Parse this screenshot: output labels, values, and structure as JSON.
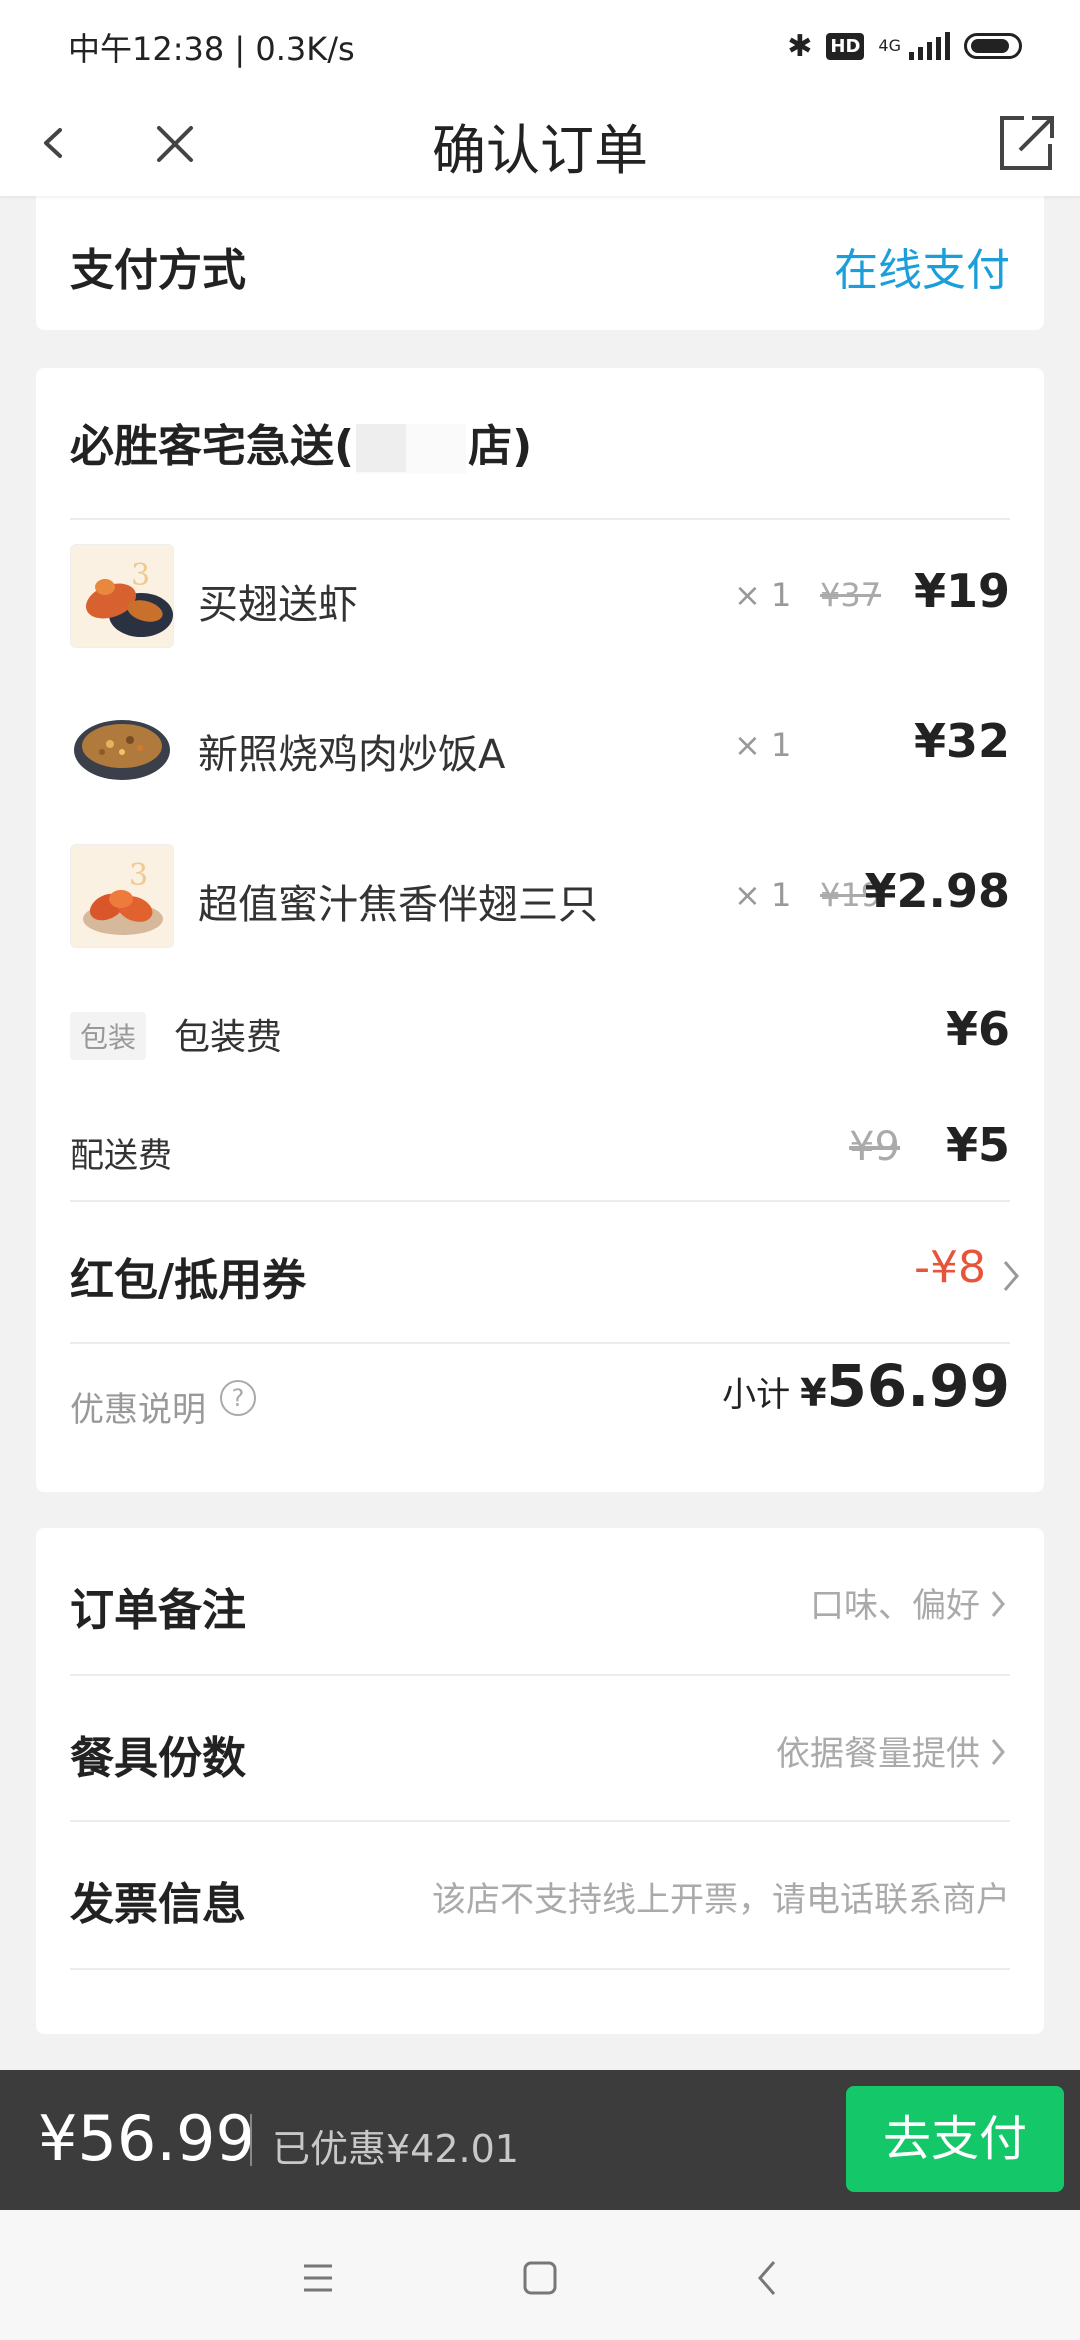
{
  "status_bar": {
    "time": "中午12:38 | 0.3K/s",
    "bluetooth": "✱",
    "hd": "HD",
    "network": "4G"
  },
  "nav": {
    "title": "确认订单",
    "back_icon": "chevron-left-icon",
    "close_icon": "close-icon",
    "share_icon": "external-link-icon"
  },
  "payment": {
    "label": "支付方式",
    "value": "在线支付"
  },
  "order": {
    "store_prefix": "必胜客宅急送(",
    "store_suffix": "店)",
    "items": [
      {
        "name": "买翅送虾",
        "qty": "× 1",
        "orig_price": "¥37",
        "price": "¥19"
      },
      {
        "name": "新照烧鸡肉炒饭A",
        "qty": "× 1",
        "orig_price": "",
        "price": "¥32"
      },
      {
        "name": "超值蜜汁焦香伴翅三只",
        "qty": "× 1",
        "orig_price": "¥19",
        "price": "¥2.98"
      }
    ],
    "packaging": {
      "tag": "包装",
      "label": "包装费",
      "price": "¥6"
    },
    "delivery": {
      "label": "配送费",
      "orig_price": "¥9",
      "price": "¥5"
    },
    "coupon": {
      "label": "红包/抵用券",
      "value": "-¥8"
    },
    "promo": {
      "label": "优惠说明",
      "help": "?"
    },
    "subtotal": {
      "label": "小计",
      "currency": "¥",
      "value": "56.99"
    }
  },
  "extras": {
    "remark": {
      "label": "订单备注",
      "hint": "口味、偏好"
    },
    "utensils": {
      "label": "餐具份数",
      "hint": "依据餐量提供"
    },
    "invoice": {
      "label": "发票信息",
      "hint": "该店不支持线上开票，请电话联系商户"
    }
  },
  "pay_bar": {
    "total": "¥56.99",
    "saved": "已优惠¥42.01",
    "button": "去支付"
  },
  "colors": {
    "accent_blue": "#1a9fdb",
    "discount_red": "#e8543a",
    "pay_green": "#14c769",
    "pay_bar_bg": "#3c3c3c"
  }
}
